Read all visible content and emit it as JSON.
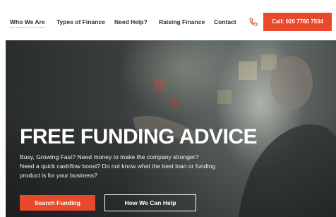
{
  "nav": {
    "items": [
      {
        "label": "Who We Are"
      },
      {
        "label": "Types of Finance"
      },
      {
        "label": "Need Help?"
      },
      {
        "label": "Raising Finance"
      },
      {
        "label": "Contact"
      }
    ],
    "phone_icon": "phone-icon",
    "call_label": "Call: 020 7760 7534"
  },
  "hero": {
    "title": "FREE FUNDING ADVICE",
    "line1": "Busy, Growing Fast? Need money to make the company stronger?",
    "line2": "Need a quick cashflow boost? Do not know what the best loan or funding",
    "line3": "product is for your business?",
    "search_button": "Search Funding",
    "how_button": "How We Can Help"
  },
  "colors": {
    "accent": "#e8492a",
    "nav_text": "#2a2a44"
  }
}
